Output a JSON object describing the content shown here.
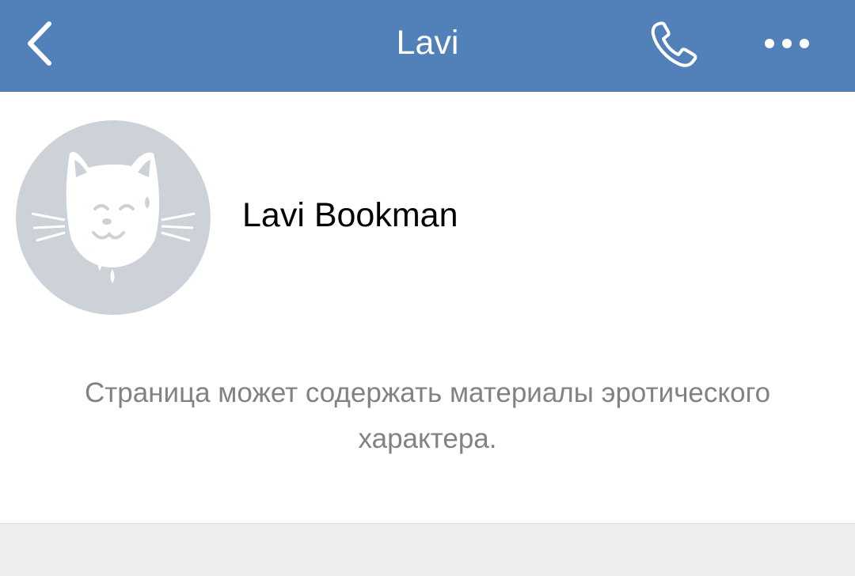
{
  "navbar": {
    "title": "Lavi",
    "back_icon": "chevron-left-icon",
    "call_icon": "phone-icon",
    "more_icon": "more-dots-icon",
    "background_color": "#5181b8"
  },
  "profile": {
    "name": "Lavi Bookman",
    "avatar": "cat-avatar"
  },
  "notice": {
    "text": "Страница может содержать материалы эротического характера."
  }
}
